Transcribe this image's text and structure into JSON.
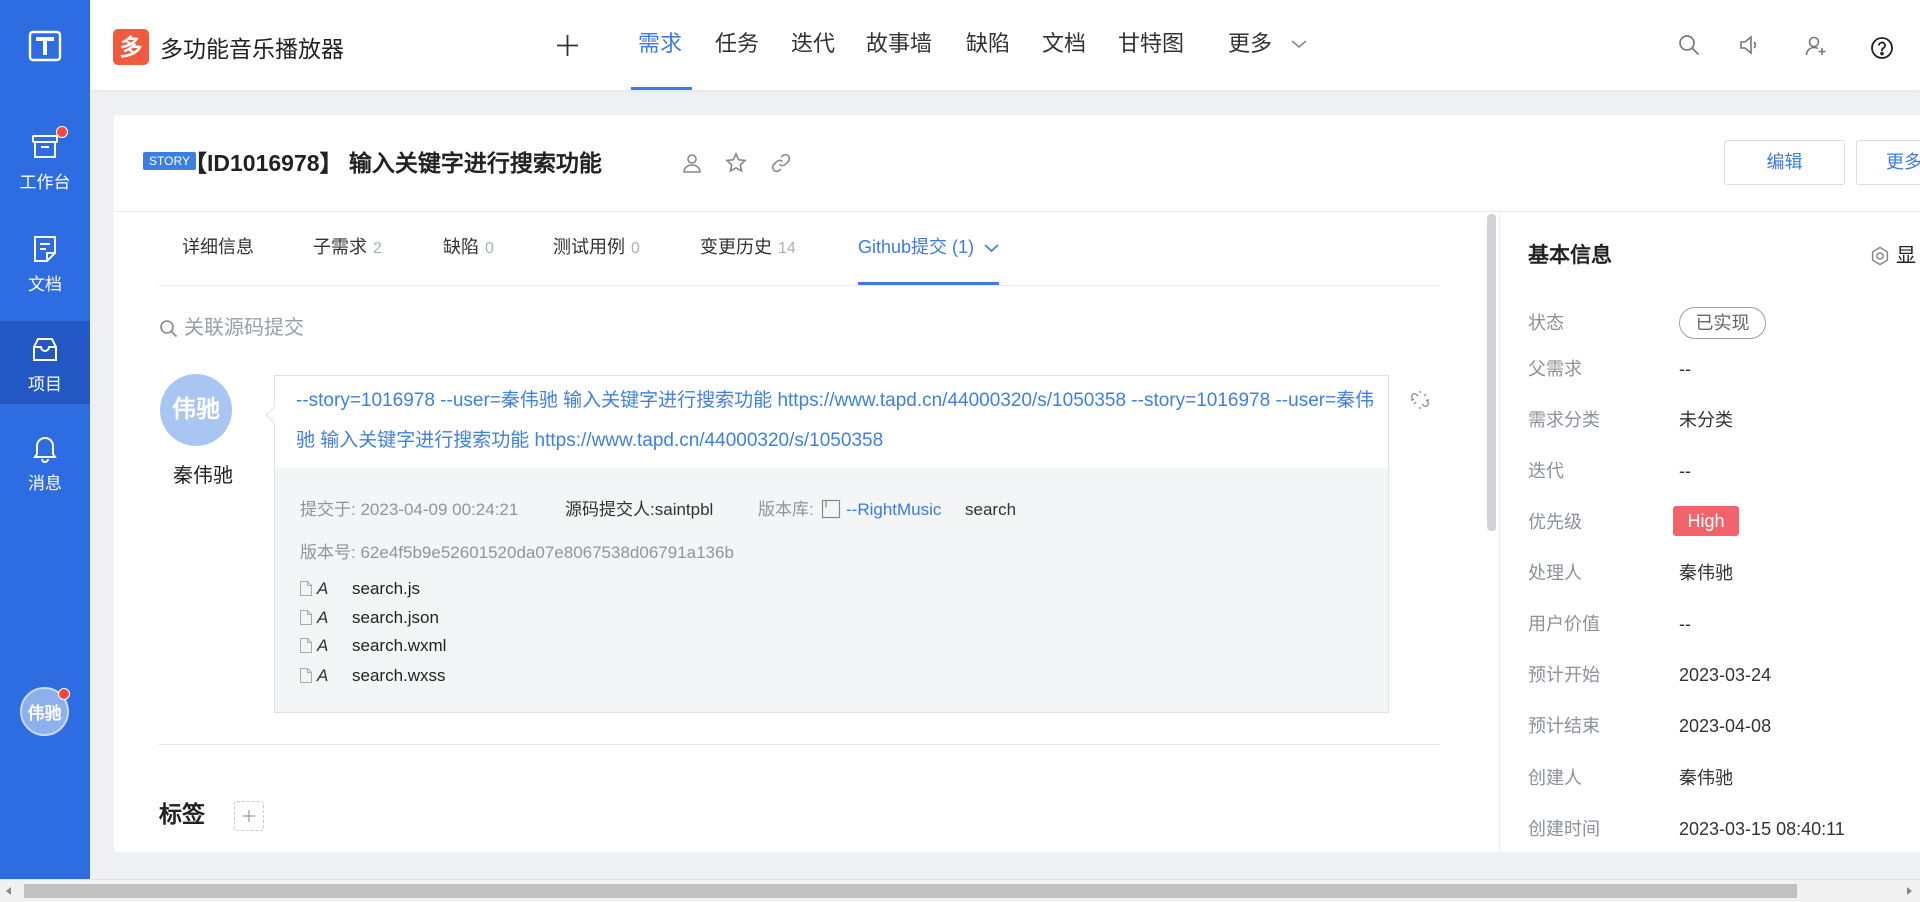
{
  "colors": {
    "sidebar": "#2d6ce1",
    "sidebar_active": "#2257c4",
    "accent": "#3a7be6",
    "brand_logo": "#f05a3f",
    "priority_high": "#f2636b",
    "notification": "#f5493d"
  },
  "app": {
    "logo_char": "多",
    "name": "多功能音乐播放器"
  },
  "sidebar": {
    "items": [
      {
        "label": "工作台",
        "icon": "inbox-tray-icon",
        "has_badge": true
      },
      {
        "label": "文档",
        "icon": "document-icon"
      },
      {
        "label": "项目",
        "icon": "project-box-icon",
        "active": true
      },
      {
        "label": "消息",
        "icon": "bell-icon"
      }
    ],
    "avatar_text": "伟驰"
  },
  "topnav": {
    "items": [
      {
        "label": "需求",
        "active": true
      },
      {
        "label": "任务"
      },
      {
        "label": "迭代"
      },
      {
        "label": "故事墙"
      },
      {
        "label": "缺陷"
      },
      {
        "label": "文档"
      },
      {
        "label": "甘特图"
      }
    ],
    "more_label": "更多",
    "right_icons": [
      "search-icon",
      "speaker-icon",
      "user-add-icon",
      "help-icon"
    ]
  },
  "story": {
    "type_badge": "STORY",
    "title": "【ID1016978】 输入关键字进行搜索功能",
    "edit_label": "编辑",
    "more_label": "更多"
  },
  "detail_tabs": [
    {
      "label": "详细信息"
    },
    {
      "label": "子需求",
      "count": 2
    },
    {
      "label": "缺陷",
      "count": 0
    },
    {
      "label": "测试用例",
      "count": 0
    },
    {
      "label": "变更历史",
      "count": 14
    },
    {
      "label": "Github提交 (1)",
      "active": true
    }
  ],
  "commits": {
    "search_placeholder": "关联源码提交",
    "items": [
      {
        "avatar_text": "伟驰",
        "author": "秦伟驰",
        "message": "--story=1016978 --user=秦伟驰 输入关键字进行搜索功能 https://www.tapd.cn/44000320/s/1050358 --story=1016978 --user=秦伟驰 输入关键字进行搜索功能 https://www.tapd.cn/44000320/s/1050358",
        "committed_label": "提交于:",
        "committed_at": "2023-04-09 00:24:21",
        "committer_label": "源码提交人:",
        "committer": "saintpbl",
        "repo_label": "版本库:",
        "repo_name": "--RightMusic",
        "branch": "search",
        "hash_label": "版本号:",
        "hash": "62e4f5b9e52601520da07e8067538d06791a136b",
        "files": [
          {
            "status": "A",
            "name": "search.js"
          },
          {
            "status": "A",
            "name": "search.json"
          },
          {
            "status": "A",
            "name": "search.wxml"
          },
          {
            "status": "A",
            "name": "search.wxss"
          }
        ]
      }
    ]
  },
  "tags": {
    "title": "标签"
  },
  "basic_info": {
    "title": "基本信息",
    "settings_label": "显",
    "fields": [
      {
        "label": "状态",
        "value": "已实现"
      },
      {
        "label": "父需求",
        "value": "--"
      },
      {
        "label": "需求分类",
        "value": "未分类"
      },
      {
        "label": "迭代",
        "value": "--"
      },
      {
        "label": "优先级",
        "value": "High"
      },
      {
        "label": "处理人",
        "value": "秦伟驰"
      },
      {
        "label": "用户价值",
        "value": "--"
      },
      {
        "label": "预计开始",
        "value": "2023-03-24"
      },
      {
        "label": "预计结束",
        "value": "2023-04-08"
      },
      {
        "label": "创建人",
        "value": "秦伟驰"
      },
      {
        "label": "创建时间",
        "value": "2023-03-15 08:40:11"
      }
    ]
  }
}
